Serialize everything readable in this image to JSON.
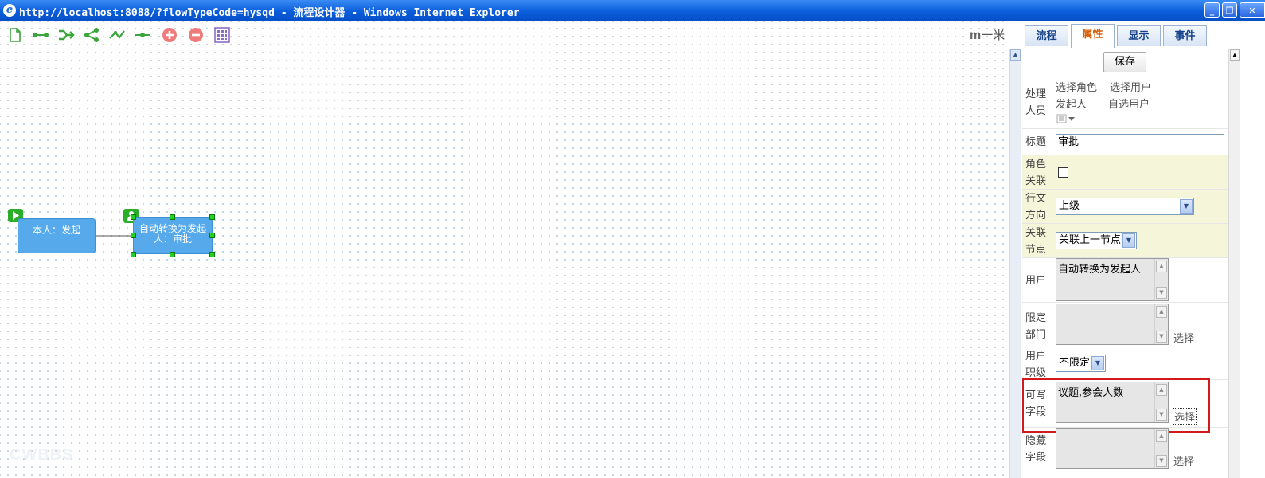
{
  "window": {
    "title": "http://localhost:8088/?flowTypeCode=hysqd - 流程设计器 - Windows Internet Explorer",
    "buttons": {
      "minimize": "_",
      "restore": "❐"
    }
  },
  "toolbar": {
    "tools": [
      "new-doc-icon",
      "connect-icon",
      "merge-icon",
      "branch-icon",
      "cross-icon",
      "line-icon",
      "add-icon",
      "remove-icon",
      "grid-icon"
    ]
  },
  "logo": {
    "mark": "m",
    "text": "一米"
  },
  "watermark": "CWBBS",
  "nodes": [
    {
      "label": "本人：发起"
    },
    {
      "label": "自动转换为发起人：审批"
    }
  ],
  "tabs": [
    {
      "label": "流程",
      "active": false
    },
    {
      "label": "属性",
      "active": true
    },
    {
      "label": "显示",
      "active": false
    },
    {
      "label": "事件",
      "active": false
    }
  ],
  "properties": {
    "save_label": "保存",
    "handler": {
      "label_l1": "处理",
      "label_l2": "人员",
      "select_role": "选择角色",
      "select_user": "选择用户",
      "initiator": "发起人",
      "self_select": "自选用户"
    },
    "title": {
      "label": "标题",
      "value": "审批"
    },
    "role_link": {
      "label_l1": "角色",
      "label_l2": "关联",
      "checked": false
    },
    "direction": {
      "label_l1": "行文",
      "label_l2": "方向",
      "value": "上级"
    },
    "link_node": {
      "label_l1": "关联",
      "label_l2": "节点",
      "value": "关联上一节点"
    },
    "user": {
      "label": "用户",
      "value": "自动转换为发起人"
    },
    "dept": {
      "label_l1": "限定",
      "label_l2": "部门",
      "value": "",
      "select": "选择"
    },
    "rank": {
      "label_l1": "用户",
      "label_l2": "职级",
      "value": "不限定"
    },
    "writable": {
      "label_l1": "可写",
      "label_l2": "字段",
      "value": "议题,参会人数",
      "select": "选择"
    },
    "hidden": {
      "label_l1": "隐藏",
      "label_l2": "字段",
      "value": "",
      "select": "选择"
    }
  },
  "colors": {
    "titlebar": "#0a5ddb",
    "node": "#56a9ea",
    "highlight": "#d11a1a",
    "handle": "#22d322"
  }
}
